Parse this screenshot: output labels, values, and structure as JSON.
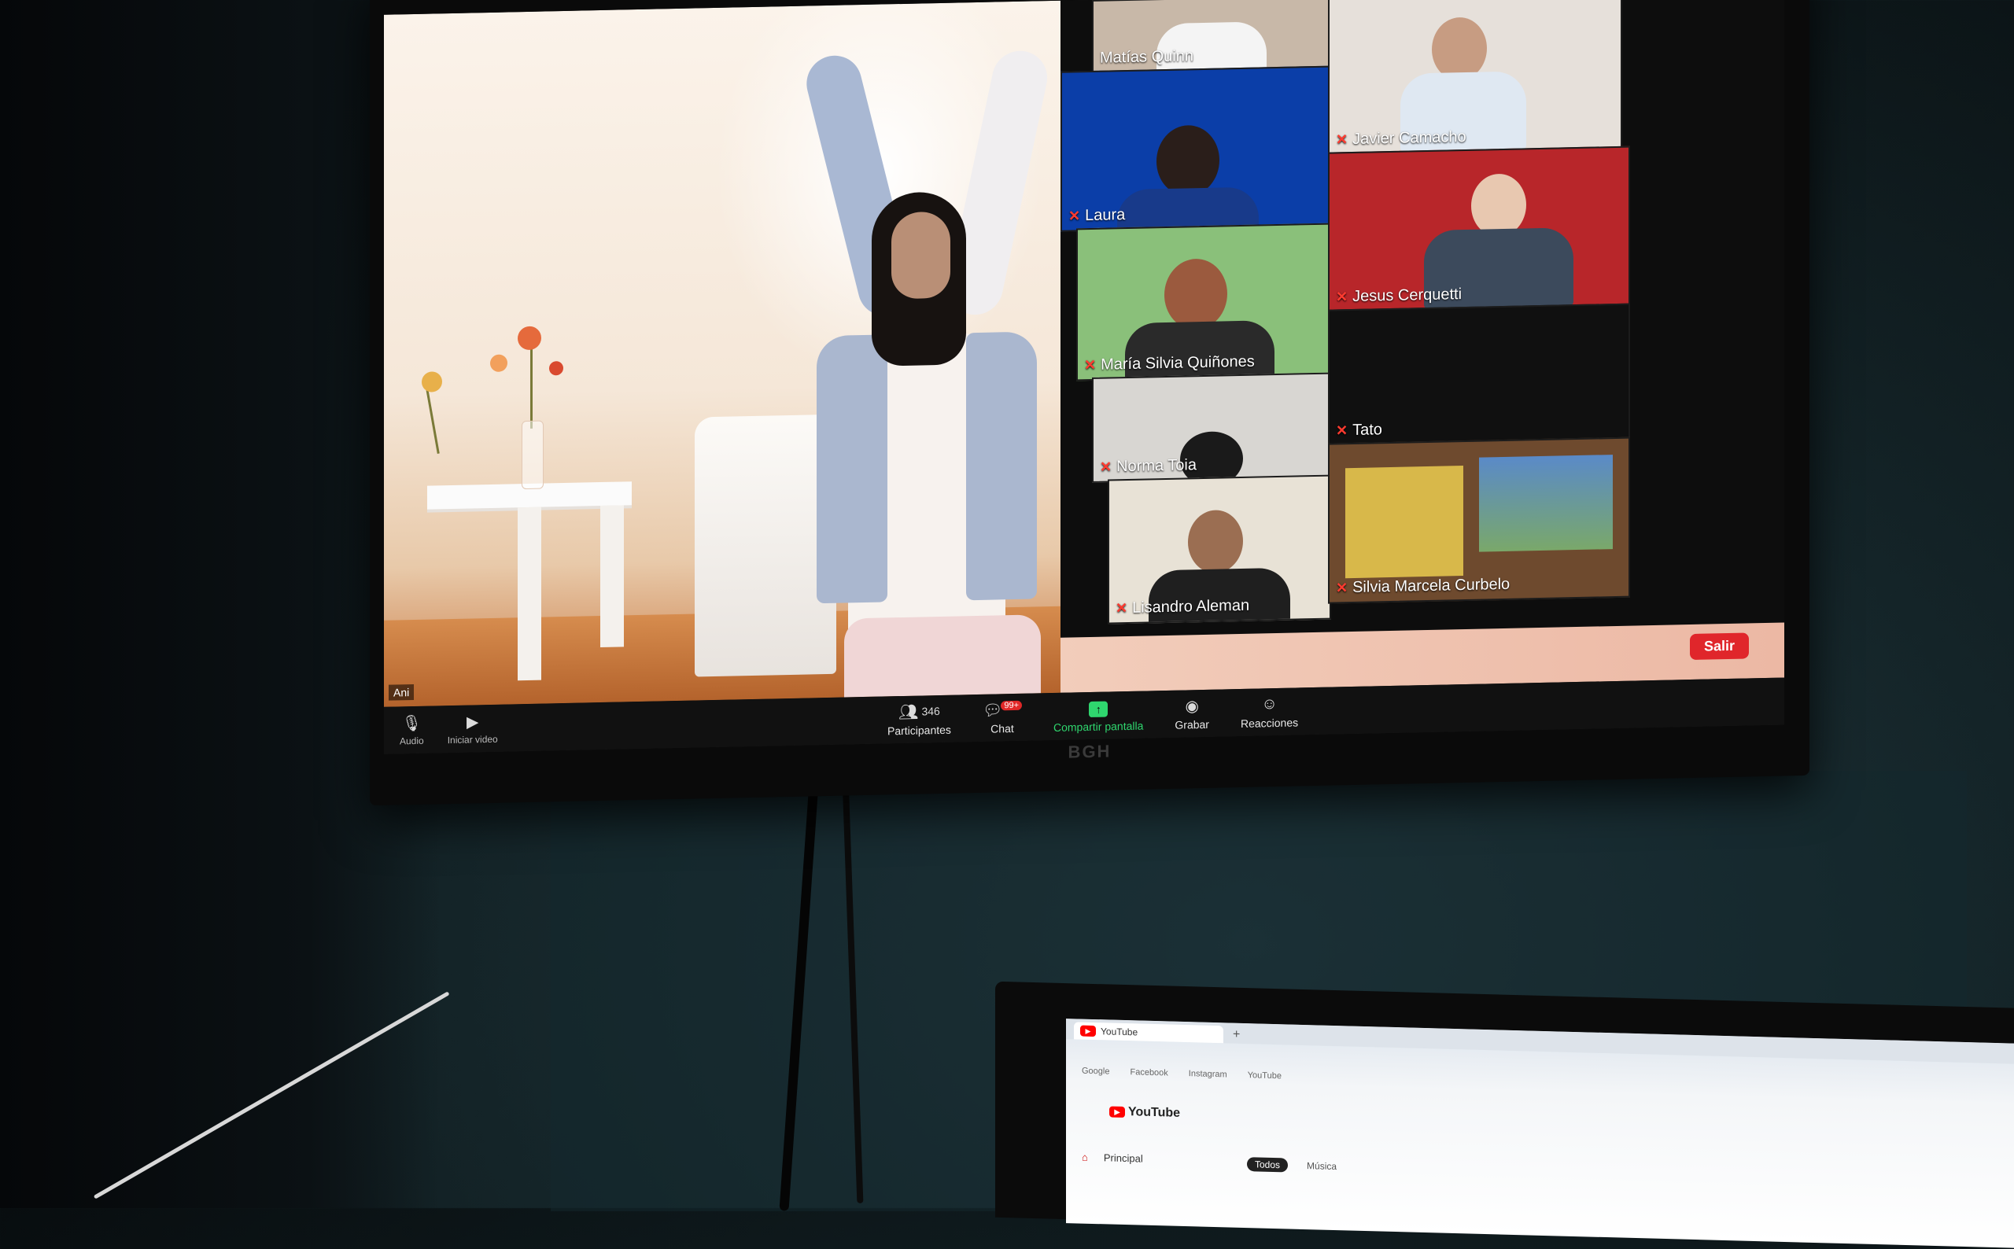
{
  "monitor": {
    "brand": "BGH"
  },
  "speaker": {
    "tag": "Ani"
  },
  "participants": [
    {
      "name": "Matías Quinn",
      "muted": false
    },
    {
      "name": "Laura",
      "muted": true
    },
    {
      "name": "Javier Camacho",
      "muted": true
    },
    {
      "name": "María Silvia Quiñones",
      "muted": true
    },
    {
      "name": "Jesus Cerquetti",
      "muted": true
    },
    {
      "name": "Norma Toia",
      "muted": true
    },
    {
      "name": "Tato",
      "muted": true
    },
    {
      "name": "Lisandro Aleman",
      "muted": true
    },
    {
      "name": "Silvia Marcela Curbelo",
      "muted": true
    }
  ],
  "toolbar": {
    "audio_label": "Audio",
    "video_label": "Iniciar video",
    "participants_label": "Participantes",
    "participants_count": "346",
    "chat_label": "Chat",
    "chat_badge": "99+",
    "share_label": "Compartir pantalla",
    "record_label": "Grabar",
    "reactions_label": "Reacciones",
    "leave_label": "Salir"
  },
  "laptop": {
    "tab_title": "YouTube",
    "bookmarks": [
      "Google",
      "Facebook",
      "Instagram",
      "YouTube"
    ],
    "yt_brand": "YouTube",
    "nav_home": "Principal",
    "chip_active": "Todos",
    "chip_other": "Música"
  },
  "colors": {
    "leave": "#e0262b",
    "share_green": "#2fd66e",
    "muted_red": "#ff3b30"
  }
}
